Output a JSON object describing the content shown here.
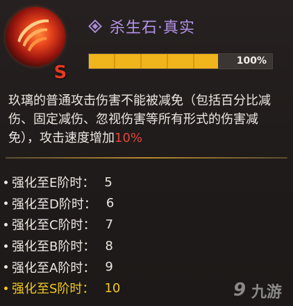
{
  "skill": {
    "title": "杀生石·真实",
    "grade": "S",
    "progress": {
      "value": 1.0,
      "label": "100%"
    },
    "description": {
      "text": "玖璃的普通攻击伤害不能被减免（包括百分比减伤、固定减伤、忽视伤害等所有形式的伤害减免），攻击速度增加",
      "highlight": "10%"
    },
    "levels": [
      {
        "label": "强化至E阶时：",
        "value": "5"
      },
      {
        "label": "强化至D阶时：",
        "value": "6"
      },
      {
        "label": "强化至C阶时：",
        "value": "7"
      },
      {
        "label": "强化至B阶时：",
        "value": "8"
      },
      {
        "label": "强化至A阶时：",
        "value": "9"
      },
      {
        "label": "强化至S阶时：",
        "value": "10"
      }
    ],
    "current_level_index": 5
  },
  "watermark": {
    "text": "九游"
  },
  "colors": {
    "title": "#b493e8",
    "highlight": "#e0453a",
    "current_level": "#f2c81f",
    "progress_fill": "#f0b41c",
    "grade": "#e23a22"
  },
  "icons": {
    "skill": "flame-slash-icon",
    "title_marker": "diamond-icon",
    "watermark": "nine-game-logo-icon"
  }
}
